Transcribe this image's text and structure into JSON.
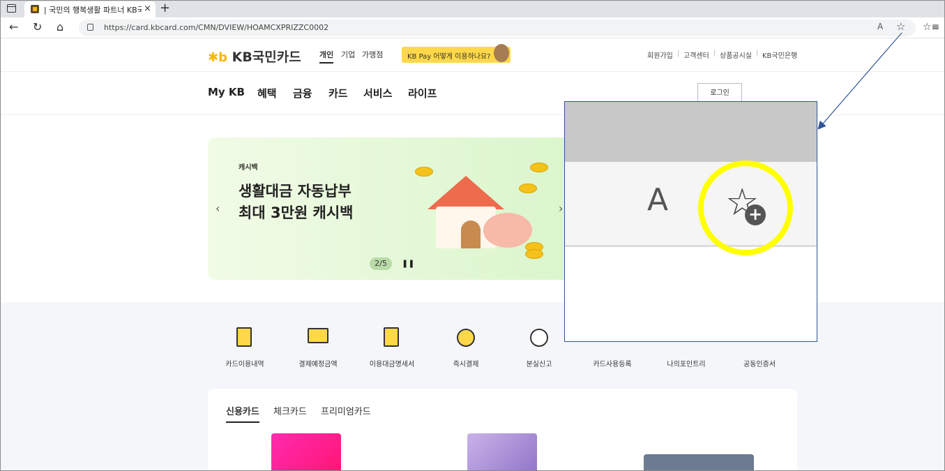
{
  "browser": {
    "tab_title": "| 국민의 행복생활 파트너 KB국민",
    "tab_close": "×",
    "new_tab": "+",
    "back": "←",
    "reload": "↻",
    "home": "⌂",
    "url": "https://card.kbcard.com/CMN/DVIEW/HOAMCXPRIZZC0002",
    "read_aloud": "A",
    "favorite_add": "☆",
    "favorites": "☆≡"
  },
  "site": {
    "logo_mark": "✱b",
    "logo_text": "KB국민카드",
    "segments": [
      "개인",
      "기업",
      "가맹점"
    ],
    "kbpay_pill": "KB Pay 어떻게 이용하나요?",
    "top_links": [
      "회원가입",
      "고객센터",
      "상품공시실",
      "KB국민은행"
    ],
    "gnb": [
      "My KB",
      "혜택",
      "금융",
      "카드",
      "서비스",
      "라이프"
    ],
    "login": "로그인",
    "search_glyph": "⌕",
    "menu_glyph": "☰"
  },
  "banner": {
    "kicker": "캐시백",
    "title_line1": "생활대금 자동납부",
    "title_line2": "최대 3만원 캐시백",
    "pager": "2/5",
    "pause": "❚❚",
    "prev": "‹",
    "next": "›"
  },
  "quick_menu": [
    "카드이용내역",
    "결제예정금액",
    "이용대금명세서",
    "즉시결제",
    "분실신고",
    "카드사용등록",
    "나의포인트리",
    "공동인증서"
  ],
  "card_tabs": [
    "신용카드",
    "체크카드",
    "프리미엄카드"
  ],
  "colors": {
    "brand_yellow": "#f6b800",
    "highlight_ring": "#ffff00",
    "callout_border": "#2f5597"
  },
  "callout": {
    "read_aloud": "A",
    "star": "☆",
    "plus": "+"
  }
}
